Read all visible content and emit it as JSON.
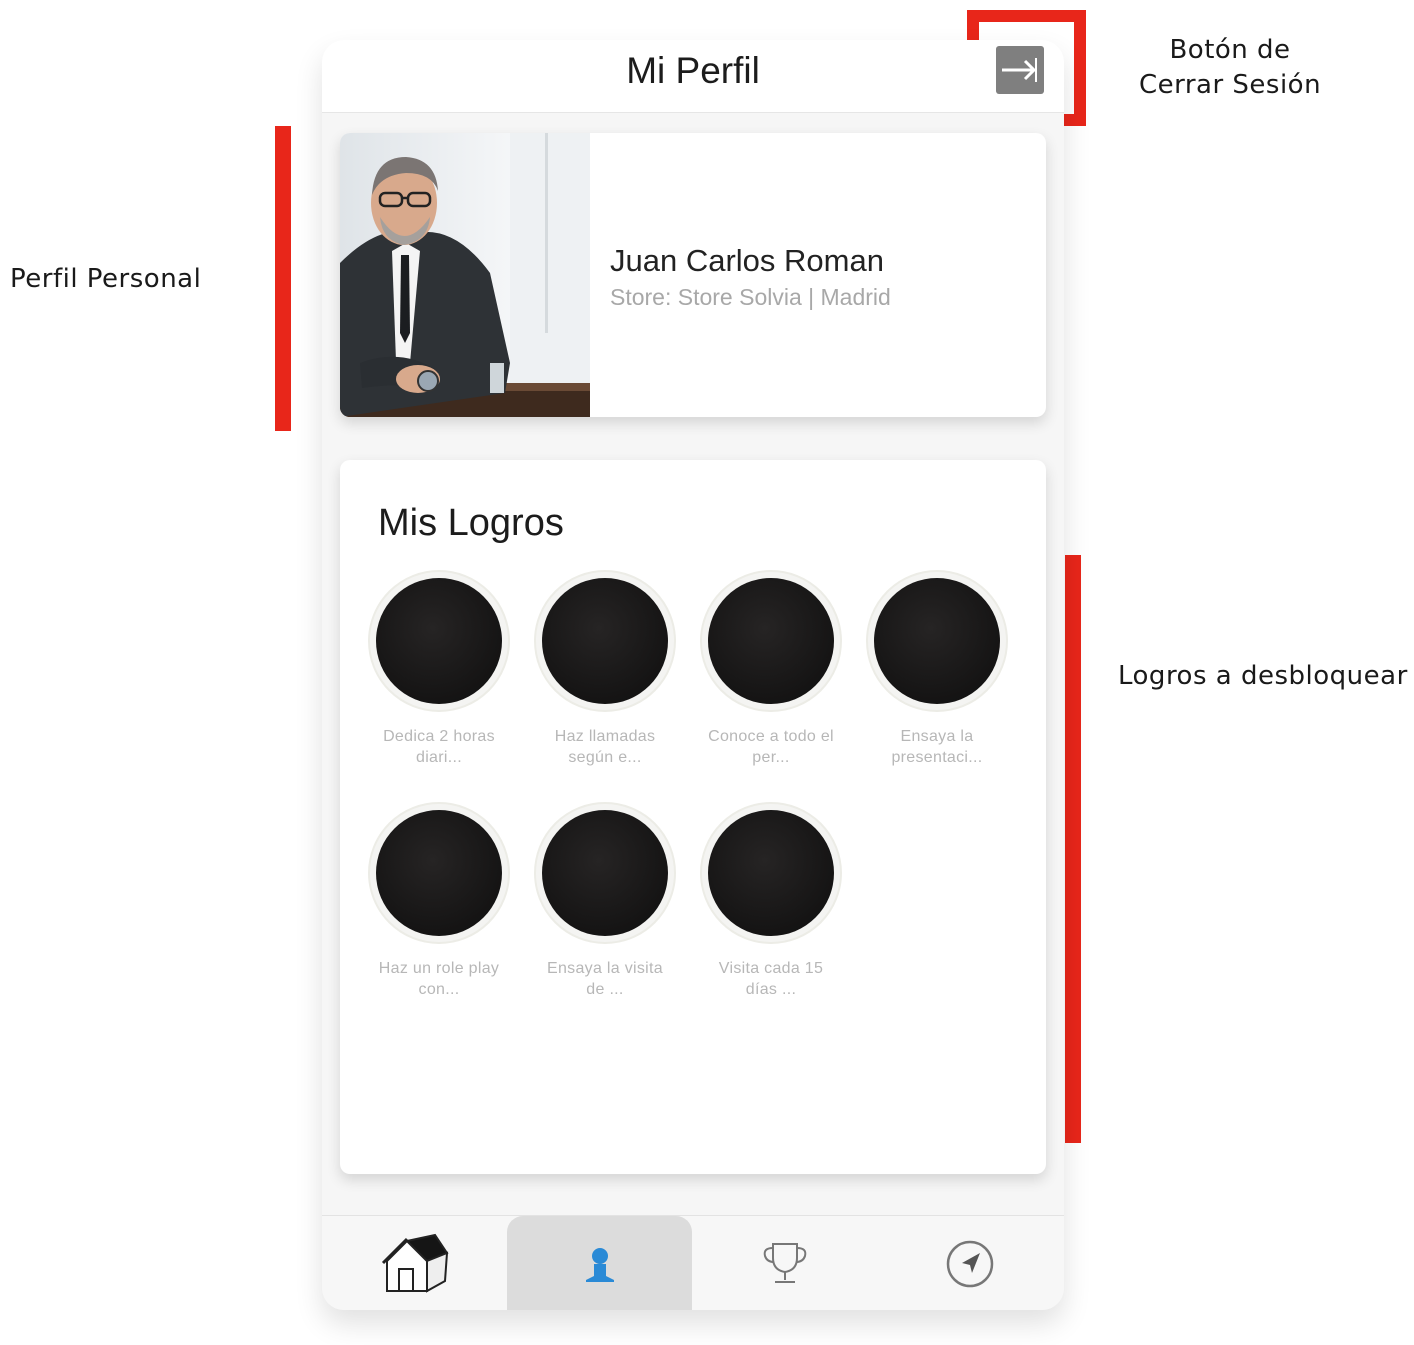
{
  "annotations": {
    "logout_label_line1": "Botón de",
    "logout_label_line2": "Cerrar Sesión",
    "profile_label": "Perfil Personal",
    "achievements_label": "Logros a desbloquear",
    "highlight_color": "#e8261a"
  },
  "header": {
    "title": "Mi Perfil",
    "logout_icon": "logout-arrow-icon"
  },
  "profile": {
    "name": "Juan Carlos Roman",
    "store": "Store: Store Solvia | Madrid"
  },
  "achievements": {
    "title": "Mis Logros",
    "items": [
      {
        "line1": "Dedica 2 horas",
        "line2": "diari..."
      },
      {
        "line1": "Haz llamadas",
        "line2": "según e..."
      },
      {
        "line1": "Conoce a todo el",
        "line2": "per..."
      },
      {
        "line1": "Ensaya la",
        "line2": "presentaci..."
      },
      {
        "line1": "Haz un role play",
        "line2": "con..."
      },
      {
        "line1": "Ensaya la visita",
        "line2": "de ..."
      },
      {
        "line1": "Visita cada 15",
        "line2": "días ..."
      }
    ]
  },
  "tabbar": {
    "tabs": [
      {
        "icon": "home-icon",
        "active": false
      },
      {
        "icon": "user-icon",
        "active": true
      },
      {
        "icon": "trophy-icon",
        "active": false
      },
      {
        "icon": "navigation-icon",
        "active": false
      }
    ],
    "active_color": "#2a8ad6"
  }
}
